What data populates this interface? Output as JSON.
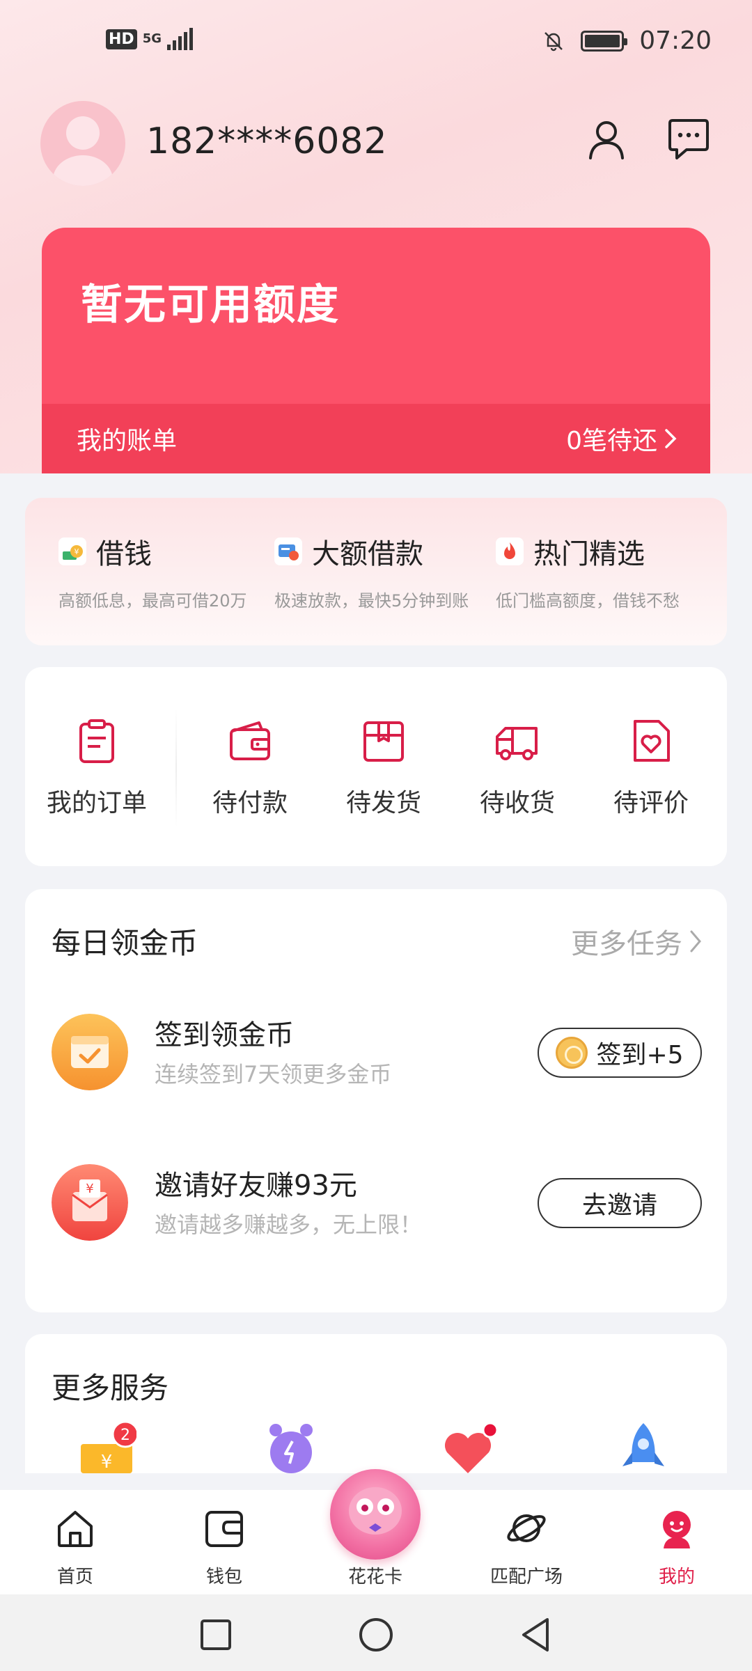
{
  "status_bar": {
    "network": "HD",
    "signal": "5G",
    "time": "07:20"
  },
  "profile": {
    "phone": "182****6082"
  },
  "credit": {
    "title": "暂无可用额度",
    "bill_label": "我的账单",
    "bill_status": "0笔待还"
  },
  "loans": [
    {
      "title": "借钱",
      "desc": "高额低息，最高可借20万"
    },
    {
      "title": "大额借款",
      "desc": "极速放款，最快5分钟到账"
    },
    {
      "title": "热门精选",
      "desc": "低门槛高额度，借钱不愁"
    }
  ],
  "orders": [
    {
      "label": "我的订单",
      "icon": "clipboard-icon"
    },
    {
      "label": "待付款",
      "icon": "wallet-icon"
    },
    {
      "label": "待发货",
      "icon": "box-icon"
    },
    {
      "label": "待收货",
      "icon": "truck-icon"
    },
    {
      "label": "待评价",
      "icon": "heart-note-icon"
    }
  ],
  "tasks": {
    "title": "每日领金币",
    "more": "更多任务",
    "items": [
      {
        "title": "签到领金币",
        "desc": "连续签到7天领更多金币",
        "button": "签到+5"
      },
      {
        "title": "邀请好友赚93元",
        "desc": "邀请越多赚越多，无上限！",
        "button": "去邀请"
      }
    ]
  },
  "services": {
    "title": "更多服务",
    "badge": "2"
  },
  "bottom_nav": [
    {
      "label": "首页",
      "icon": "home-icon"
    },
    {
      "label": "钱包",
      "icon": "wallet-icon"
    },
    {
      "label": "花花卡",
      "icon": "huahua-card-icon"
    },
    {
      "label": "匹配广场",
      "icon": "planet-icon"
    },
    {
      "label": "我的",
      "icon": "mine-icon",
      "active": true
    }
  ],
  "colors": {
    "brand": "#fc5169",
    "brand_dark": "#f24058",
    "accent": "#e0204a"
  }
}
